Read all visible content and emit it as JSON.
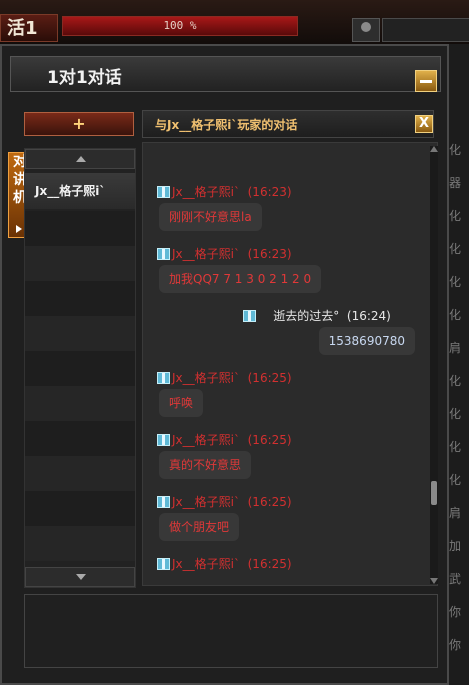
{
  "topbar": {
    "left_label": "活1",
    "progress_text": "100 %",
    "progress_fraction": 1.0
  },
  "window": {
    "title": "1对1对话",
    "add_label": "+",
    "side_tab": [
      "对",
      "讲",
      "机"
    ],
    "contact_name": "Jx__格子熙i`",
    "chat_title": "与Jx__格子熙i`玩家的对话",
    "close_label": "X"
  },
  "right_strip": [
    "化",
    "器",
    "化",
    "化",
    "化",
    "化",
    "肩",
    "化",
    "化",
    "化",
    "化",
    "肩",
    "加",
    "武",
    "你",
    "你"
  ],
  "messages": [
    {
      "side": "them",
      "name": "Jx__格子熙i`",
      "time": "(16:23)",
      "text": "刚刚不好意思la"
    },
    {
      "side": "them",
      "name": "Jx__格子熙i`",
      "time": "(16:23)",
      "text": "加我QQ7 7 1 3 0 2 1 2 0"
    },
    {
      "side": "me",
      "name": "逝去的过去°",
      "time": "(16:24)",
      "text": "1538690780"
    },
    {
      "side": "them",
      "name": "Jx__格子熙i`",
      "time": "(16:25)",
      "text": "呼唤"
    },
    {
      "side": "them",
      "name": "Jx__格子熙i`",
      "time": "(16:25)",
      "text": "真的不好意思"
    },
    {
      "side": "them",
      "name": "Jx__格子熙i`",
      "time": "(16:25)",
      "text": "做个朋友吧"
    },
    {
      "side": "them",
      "name": "Jx__格子熙i`",
      "time": "(16:25)",
      "text": ""
    }
  ],
  "scroll": {
    "position_fraction": 0.82
  }
}
